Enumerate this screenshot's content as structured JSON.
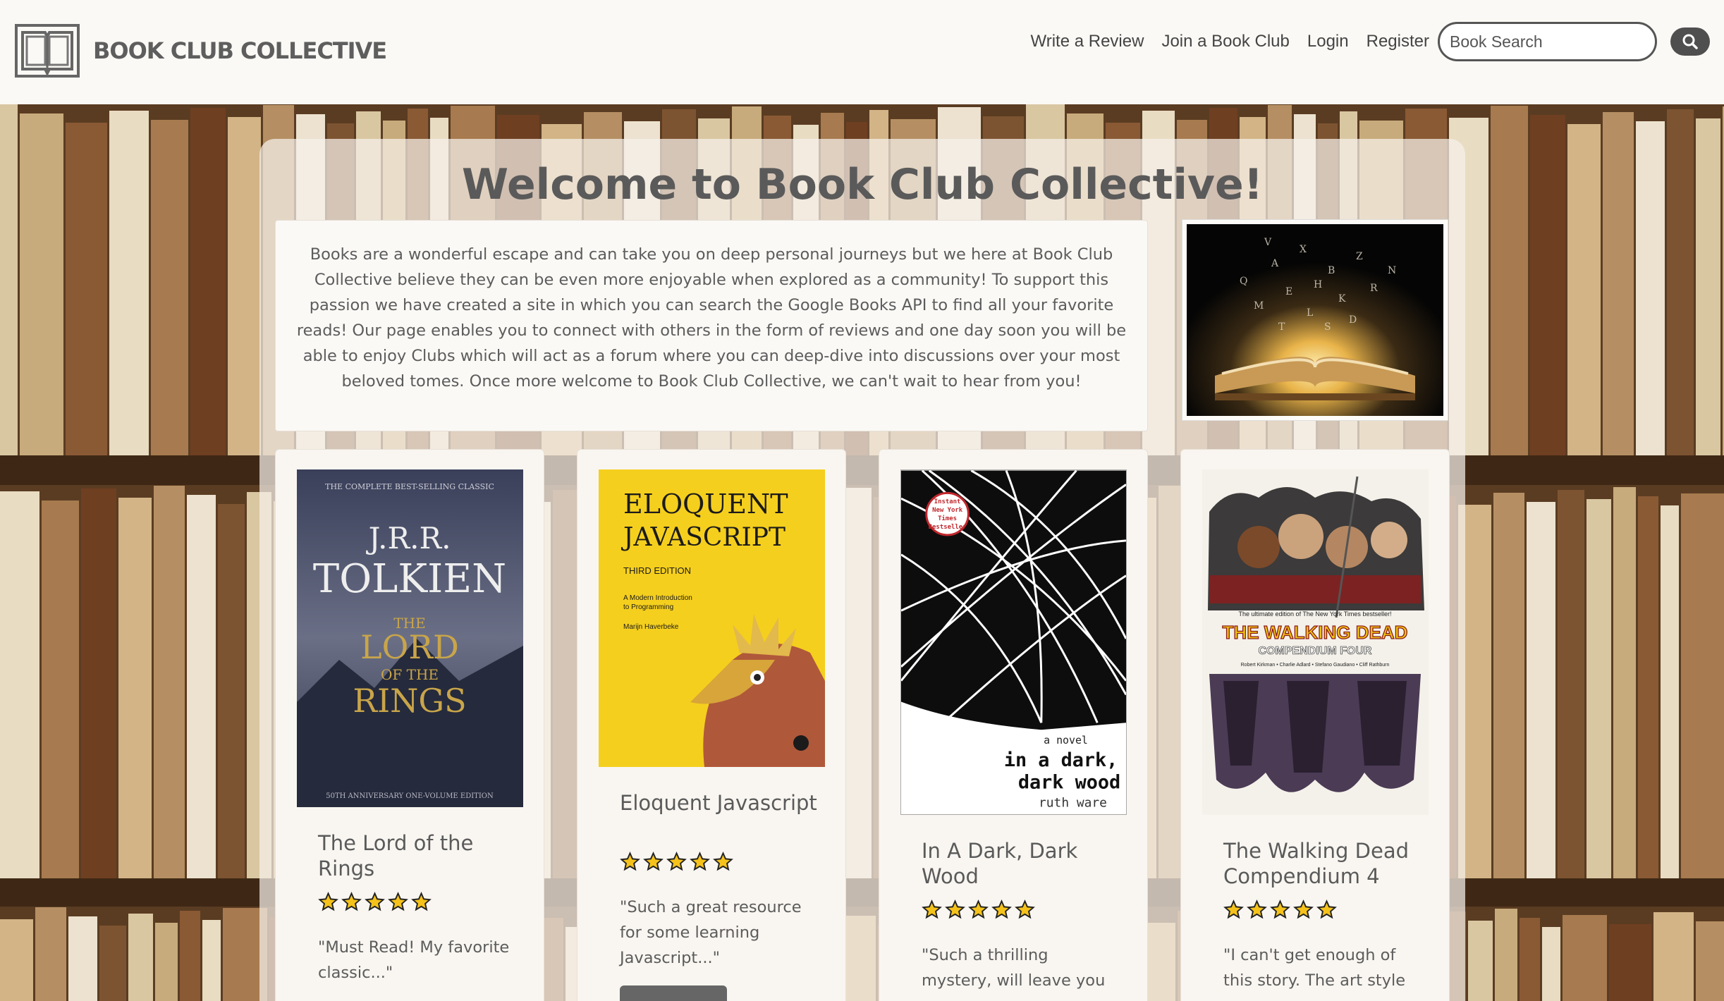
{
  "brand": {
    "name": "BOOK CLUB COLLECTIVE"
  },
  "nav": {
    "links": [
      "Write a Review",
      "Join a Book Club",
      "Login",
      "Register"
    ]
  },
  "search": {
    "placeholder": "Book Search"
  },
  "welcome": {
    "heading": "Welcome to Book Club Collective!",
    "body": "Books are a wonderful escape and can take you on deep personal journeys but we here at Book Club Collective believe they can be even more enjoyable when explored as a community! To support this passion we have created a site in which you can search the Google Books API to find all your favorite reads! Our page enables you to connect with others in the form of reviews and one day soon you will be able to enjoy Clubs which will act as a forum where you can deep-dive into discussions over your most beloved tomes. Once more welcome to Book Club Collective, we can't wait to hear from you!"
  },
  "books": [
    {
      "title": "The Lord of the Rings",
      "rating": 5,
      "quote": "\"Must Read! My favorite classic...\"",
      "cover": {
        "top_line": "THE COMPLETE BEST-SELLING CLASSIC",
        "author_a": "J.R.R.",
        "author_b": "TOLKIEN",
        "t1": "THE",
        "t2": "LORD",
        "t3": "OF THE",
        "t4": "RINGS",
        "bottom_line": "50TH ANNIVERSARY ONE-VOLUME EDITION"
      }
    },
    {
      "title": "Eloquent Javascript",
      "rating": 5,
      "quote": "\"Such a great resource for some learning Javascript...\"",
      "cover": {
        "t1": "ELOQUENT",
        "t2": "JAVASCRIPT",
        "edition": "THIRD EDITION",
        "sub1": "A Modern Introduction",
        "sub2": "to Programming",
        "author": "Marijn Haverbeke"
      }
    },
    {
      "title": "In A Dark, Dark Wood",
      "rating": 5,
      "quote": "\"Such a thrilling mystery, will leave you",
      "cover": {
        "badge1": "Instant",
        "badge2": "New York",
        "badge3": "Times",
        "badge4": "Bestseller",
        "kicker": "a novel",
        "t1": "in a dark,",
        "t2": "dark wood",
        "author": "ruth ware"
      }
    },
    {
      "title": "The Walking Dead Compendium 4",
      "rating": 5,
      "quote": "\"I can't get enough of this story. The art style",
      "cover": {
        "tag": "The ultimate edition of The New York Times bestseller!",
        "t1": "THE WALKING DEAD",
        "t2": "COMPENDIUM FOUR",
        "credits": "Robert Kirkman • Charlie Adlard • Stefano Gaudiano • Cliff Rathburn"
      }
    }
  ],
  "colors": {
    "accent": "#4f4f4f",
    "star": "#f5c21b"
  }
}
